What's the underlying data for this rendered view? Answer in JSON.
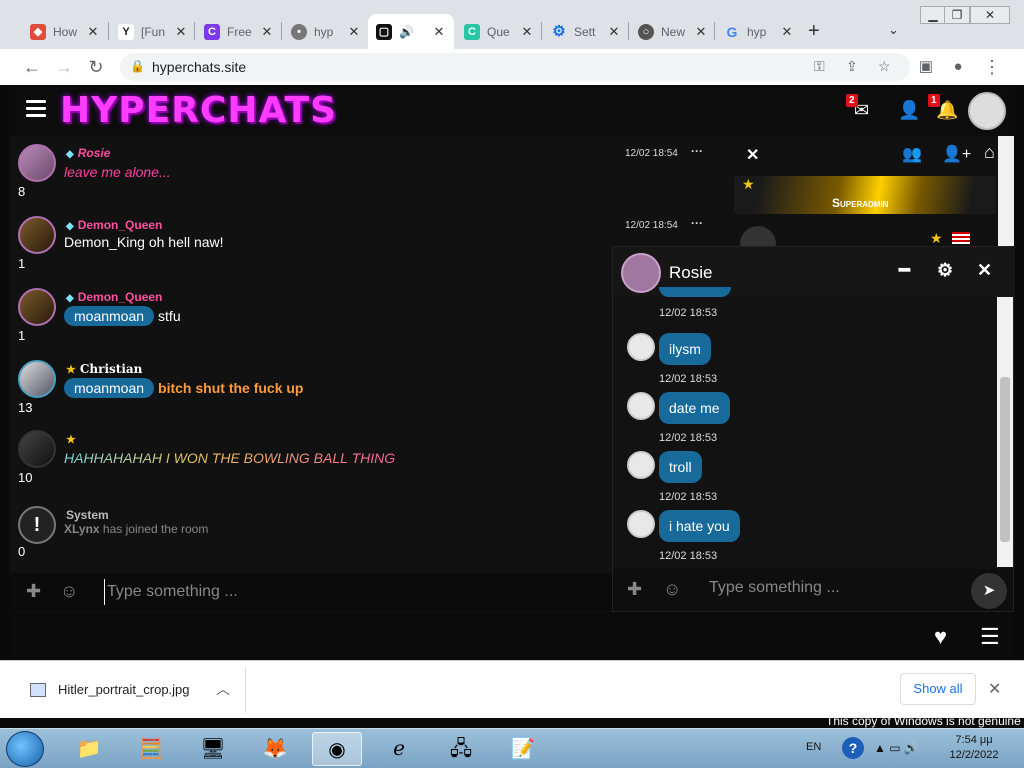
{
  "browser": {
    "tabs": [
      {
        "title": "How",
        "icon": "multicolor-icon",
        "color": "#e14b3b"
      },
      {
        "title": "[Fun",
        "icon": "yahoo-icon",
        "color": "#222"
      },
      {
        "title": "Free",
        "icon": "c-icon",
        "color": "#7c3aed"
      },
      {
        "title": "hyp",
        "icon": "globe-icon",
        "color": "#777"
      },
      {
        "title": "",
        "icon": "chat-icon",
        "color": "#111",
        "active": true,
        "audio": true
      },
      {
        "title": "Que",
        "icon": "q-icon",
        "color": "#26c6a6"
      },
      {
        "title": "Sett",
        "icon": "gear-icon",
        "color": "#1a73e8"
      },
      {
        "title": "New",
        "icon": "chrome-icon",
        "color": "#555"
      },
      {
        "title": "hyp",
        "icon": "google-icon",
        "color": "#4285f4"
      }
    ],
    "url": "hyperchats.site"
  },
  "site": {
    "logo": "HYPERCHATS",
    "messages_badge": "2",
    "notifications_badge": "1"
  },
  "chat": {
    "messages": [
      {
        "user": "Rosie",
        "time": "12/02 18:54",
        "count": "8",
        "text": "leave me alone...",
        "badge": "gem",
        "user_color": "#ff4fa0",
        "text_color": "#ff3fa0",
        "italic": true
      },
      {
        "user": "Demon_Queen",
        "time": "12/02 18:54",
        "count": "1",
        "mention": "",
        "text": "Demon_King oh hell naw!",
        "badge": "gem",
        "user_color": "#ff4fa0",
        "text_color": "#ffffff"
      },
      {
        "user": "Demon_Queen",
        "time": "",
        "count": "1",
        "mention": "moanmoan",
        "text": "stfu",
        "badge": "gem",
        "user_color": "#ff4fa0",
        "text_color": "#ffffff"
      },
      {
        "user": "Christian",
        "time": "",
        "count": "13",
        "mention": "moanmoan",
        "text": "bitch shut the fuck up",
        "badge": "star",
        "user_color": "#ffffff",
        "text_color": "#ff9a3c"
      },
      {
        "user": "",
        "time": "",
        "count": "10",
        "text": "HAHHAHAHAH I WON THE BOWLING BALL THING",
        "badge": "star",
        "user_color": "#111111",
        "text_color": "#d9b84a",
        "italic": true
      },
      {
        "user": "System",
        "time": "",
        "count": "0",
        "text_user": "XLynx",
        "text": "has joined the room",
        "badge": "",
        "user_color": "#bbbbbb",
        "text_color": "#888888"
      }
    ],
    "input_placeholder": "Type something ..."
  },
  "userpanel": {
    "rank_label": "Superadmin"
  },
  "private_chat": {
    "name": "Rosie",
    "messages": [
      {
        "text": "",
        "time": "12/02 18:53"
      },
      {
        "text": "ilysm",
        "time": "12/02 18:53"
      },
      {
        "text": "date me",
        "time": "12/02 18:53"
      },
      {
        "text": "troll",
        "time": "12/02 18:53"
      },
      {
        "text": "i hate you",
        "time": "12/02 18:53"
      }
    ],
    "input_placeholder": "Type something ..."
  },
  "download": {
    "filename": "Hitler_portrait_crop.jpg",
    "show_all": "Show all"
  },
  "windows": {
    "watermark": "This copy of Windows is not genuine",
    "lang": "EN",
    "time": "7:54 μμ",
    "date": "12/2/2022"
  }
}
